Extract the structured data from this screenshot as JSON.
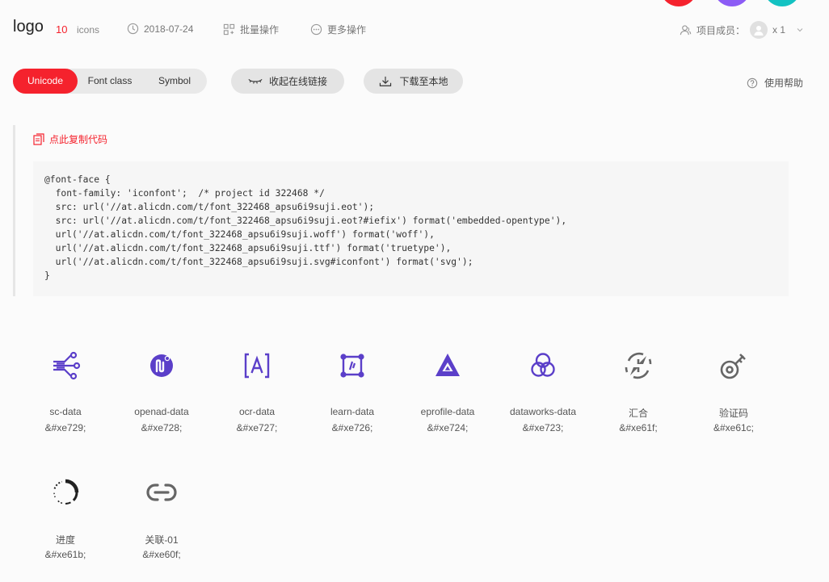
{
  "header": {
    "title": "logo",
    "count": "10",
    "count_unit": "icons",
    "date": "2018-07-24",
    "batch_label": "批量操作",
    "more_label": "更多操作",
    "members_label": "项目成员：",
    "members_count": "x 1"
  },
  "toolbar": {
    "tabs": [
      "Unicode",
      "Font class",
      "Symbol"
    ],
    "active_tab": "Unicode",
    "collapse_label": "收起在线链接",
    "download_label": "下载至本地",
    "help_label": "使用帮助"
  },
  "code_section": {
    "copy_label": "点此复制代码",
    "code": "@font-face {\n  font-family: 'iconfont';  /* project id 322468 */\n  src: url('//at.alicdn.com/t/font_322468_apsu6i9suji.eot');\n  src: url('//at.alicdn.com/t/font_322468_apsu6i9suji.eot?#iefix') format('embedded-opentype'),\n  url('//at.alicdn.com/t/font_322468_apsu6i9suji.woff') format('woff'),\n  url('//at.alicdn.com/t/font_322468_apsu6i9suji.ttf') format('truetype'),\n  url('//at.alicdn.com/t/font_322468_apsu6i9suji.svg#iconfont') format('svg');\n}"
  },
  "icons": [
    {
      "name": "sc-data",
      "code": "&#xe729;",
      "icon": "sc-data-icon"
    },
    {
      "name": "openad-data",
      "code": "&#xe728;",
      "icon": "openad-data-icon"
    },
    {
      "name": "ocr-data",
      "code": "&#xe727;",
      "icon": "ocr-data-icon"
    },
    {
      "name": "learn-data",
      "code": "&#xe726;",
      "icon": "learn-data-icon"
    },
    {
      "name": "eprofile-data",
      "code": "&#xe724;",
      "icon": "eprofile-data-icon"
    },
    {
      "name": "dataworks-data",
      "code": "&#xe723;",
      "icon": "dataworks-data-icon"
    },
    {
      "name": "汇合",
      "code": "&#xe61f;",
      "icon": "merge-icon"
    },
    {
      "name": "验证码",
      "code": "&#xe61c;",
      "icon": "captcha-key-icon"
    },
    {
      "name": "进度",
      "code": "&#xe61b;",
      "icon": "progress-icon"
    },
    {
      "name": "关联-01",
      "code": "&#xe60f;",
      "icon": "link-icon"
    }
  ],
  "colors": {
    "accent": "#f5222d",
    "purple_icon": "#5b3fc9",
    "gray_icon": "#666666"
  }
}
